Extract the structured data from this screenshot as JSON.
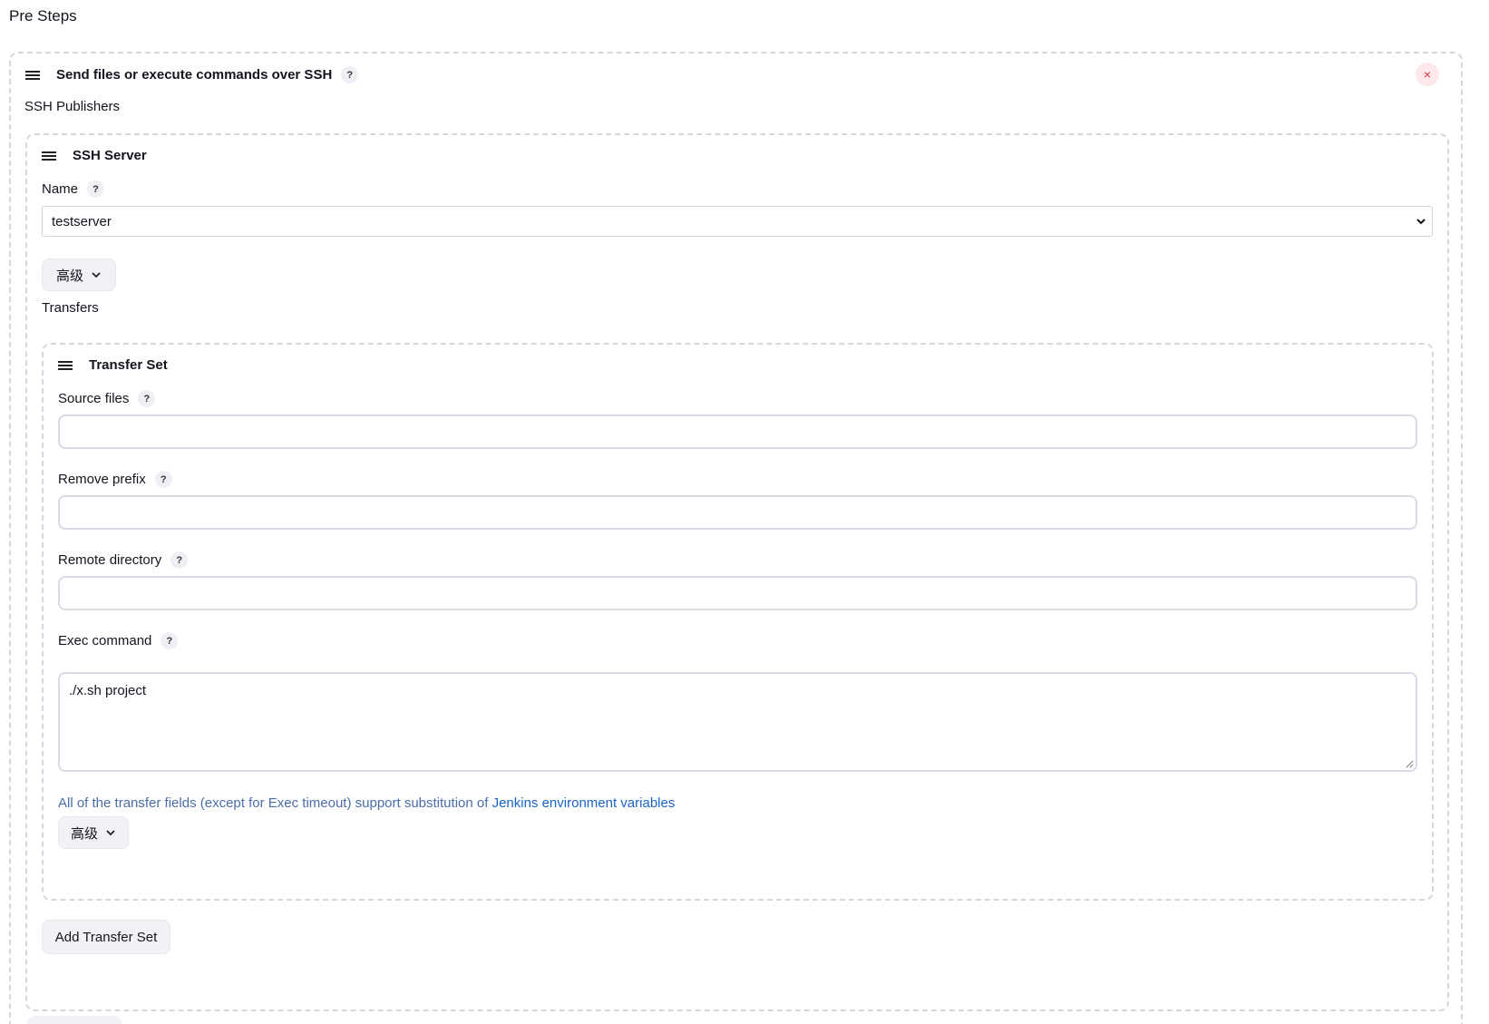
{
  "page": {
    "title": "Pre Steps"
  },
  "step": {
    "title": "Send files or execute commands over SSH",
    "help": "?",
    "close_symbol": "×",
    "publishers_label": "SSH Publishers"
  },
  "server": {
    "title": "SSH Server",
    "name_label": "Name",
    "help": "?",
    "name_value": "testserver",
    "advanced_label": "高级",
    "transfers_label": "Transfers"
  },
  "transfer_set": {
    "title": "Transfer Set",
    "source_files_label": "Source files",
    "source_files_value": "",
    "remove_prefix_label": "Remove prefix",
    "remove_prefix_value": "",
    "remote_directory_label": "Remote directory",
    "remote_directory_value": "",
    "exec_command_label": "Exec command",
    "exec_command_value": "./x.sh project",
    "help": "?",
    "note_text": "All of the transfer fields (except for Exec timeout) support substitution of ",
    "note_link": "Jenkins environment variables",
    "advanced_label": "高级"
  },
  "actions": {
    "add_transfer_set_label": "Add Transfer Set"
  },
  "colors": {
    "accent_link": "#1a64c8",
    "close_red": "#d9303e",
    "dashed_border": "#d4d6e0"
  }
}
